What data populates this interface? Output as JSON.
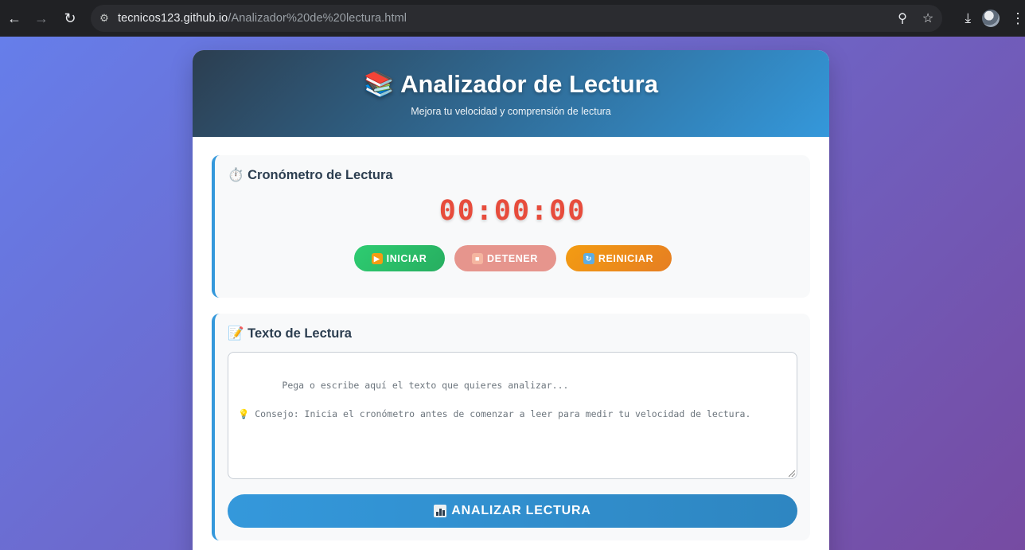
{
  "browser": {
    "url_host": "tecnicos123.github.io",
    "url_path": "/Analizador%20de%20lectura.html"
  },
  "header": {
    "title": "📚 Analizador de Lectura",
    "subtitle": "Mejora tu velocidad y comprensión de lectura"
  },
  "timer": {
    "heading": "⏱️ Cronómetro de Lectura",
    "display": "00:00:00",
    "start_label": "INICIAR",
    "stop_label": "DETENER",
    "reset_label": "REINICIAR"
  },
  "reading": {
    "heading": "📝 Texto de Lectura",
    "placeholder": "Pega o escribe aquí el texto que quieres analizar...\n\n💡 Consejo: Inicia el cronómetro antes de comenzar a leer para medir tu velocidad de lectura.",
    "analyze_label": "ANALIZAR LECTURA"
  }
}
